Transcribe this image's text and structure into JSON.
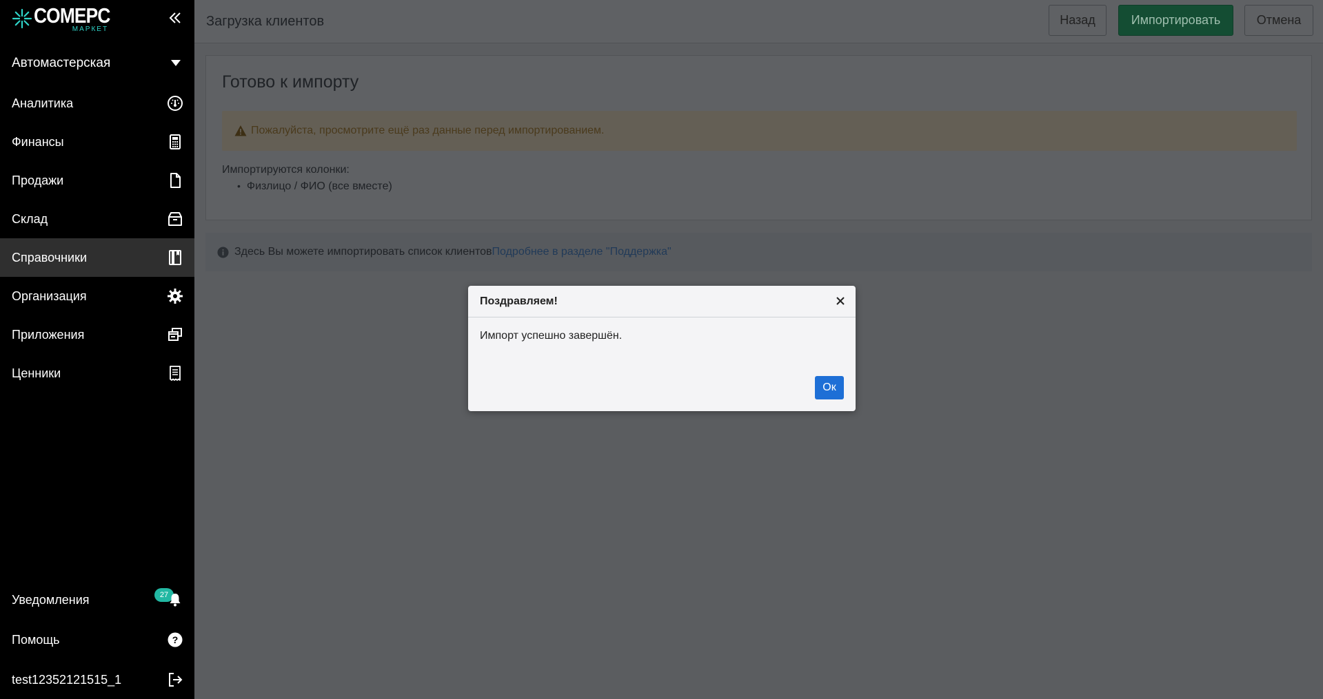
{
  "brand": {
    "name": "COMEPC",
    "sub": "МАРКЕТ",
    "accent": "#2fd3c8"
  },
  "sidebar": {
    "store": "Автомастерская",
    "items": [
      {
        "label": "Аналитика",
        "icon": "gauge-icon"
      },
      {
        "label": "Финансы",
        "icon": "calculator-icon"
      },
      {
        "label": "Продажи",
        "icon": "document-icon"
      },
      {
        "label": "Склад",
        "icon": "box-icon"
      },
      {
        "label": "Справочники",
        "icon": "book-icon",
        "active": true
      },
      {
        "label": "Организация",
        "icon": "gear-icon"
      },
      {
        "label": "Приложения",
        "icon": "windows-icon"
      },
      {
        "label": "Ценники",
        "icon": "receipt-icon"
      }
    ],
    "notifications": {
      "label": "Уведомления",
      "count": "27"
    },
    "help": {
      "label": "Помощь"
    },
    "user": {
      "label": "test12352121515_1"
    }
  },
  "header": {
    "title": "Загрузка клиентов",
    "back_label": "Назад",
    "import_label": "Импортировать",
    "cancel_label": "Отмена"
  },
  "card": {
    "title": "Готово к импорту",
    "warning": "Пожалуйста, просмотрите ещё раз данные перед импортированием.",
    "columns_label": "Импортируются колонки:",
    "columns": [
      "Физлицо / ФИО (все вместе)"
    ]
  },
  "info": {
    "text": "Здесь Вы можете импортировать список клиентов",
    "link": "Подробнее в разделе \"Поддержка\""
  },
  "modal": {
    "title": "Поздравляем!",
    "body": "Импорт успешно завершён.",
    "ok_label": "Ок"
  }
}
